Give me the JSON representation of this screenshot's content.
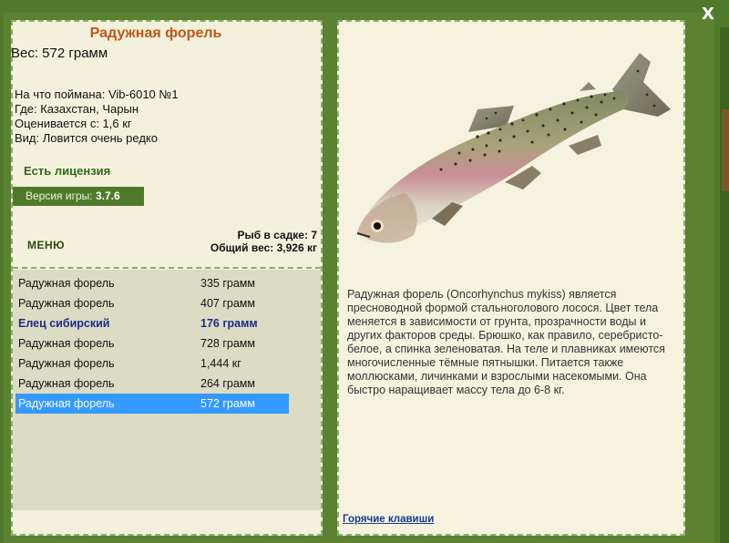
{
  "close_label": "X",
  "fish": {
    "title": "Радужная форель",
    "weight": "Вес: 572 грамм",
    "caught_on": "На что поймана: Vib-6010 №1",
    "location": "Где: Казахстан, Чарын",
    "valued_from": "Оценивается с: 1,6 кг",
    "rarity": "Вид: Ловится очень редко",
    "description": "Радужная форель (Oncorhynchus mykiss) является пресноводной формой стальноголового лосося. Цвет тела меняется в зависимости от грунта, прозрачности воды и других факторов среды. Брюшко, как правило, серебристо-белое, а спинка зеленоватая. На теле и плавниках имеются многочисленные тёмные пятнышки. Питается также моллюсками, личинками и взрослыми насекомыми. Она быстро наращивает массу тела до 6-8 кг."
  },
  "license": "Есть лицензия",
  "version": {
    "label": "Версия игры:",
    "value": "3.7.6"
  },
  "menu_label": "МЕНЮ",
  "keepnet": {
    "count": "Рыб в садке: 7",
    "total": "Общий вес: 3,926 кг"
  },
  "catches": [
    {
      "name": "Радужная форель",
      "weight": "335 грамм"
    },
    {
      "name": "Радужная форель",
      "weight": "407 грамм"
    },
    {
      "name": "Елец сибирский",
      "weight": "176 грамм"
    },
    {
      "name": "Радужная форель",
      "weight": "728 грамм"
    },
    {
      "name": "Радужная форель",
      "weight": "1,444 кг"
    },
    {
      "name": "Радужная форель",
      "weight": "264 грамм"
    },
    {
      "name": "Радужная форель",
      "weight": "572 грамм"
    }
  ],
  "hotkeys_label": "Горячие клавиши",
  "colors": {
    "background": "#4f7a2c",
    "panel": "#f3f1de",
    "title": "#c05812",
    "license": "#2e6a15",
    "selection": "#3399ff",
    "rare_fish": "#1d2a8a",
    "link": "#1a3a8c"
  }
}
